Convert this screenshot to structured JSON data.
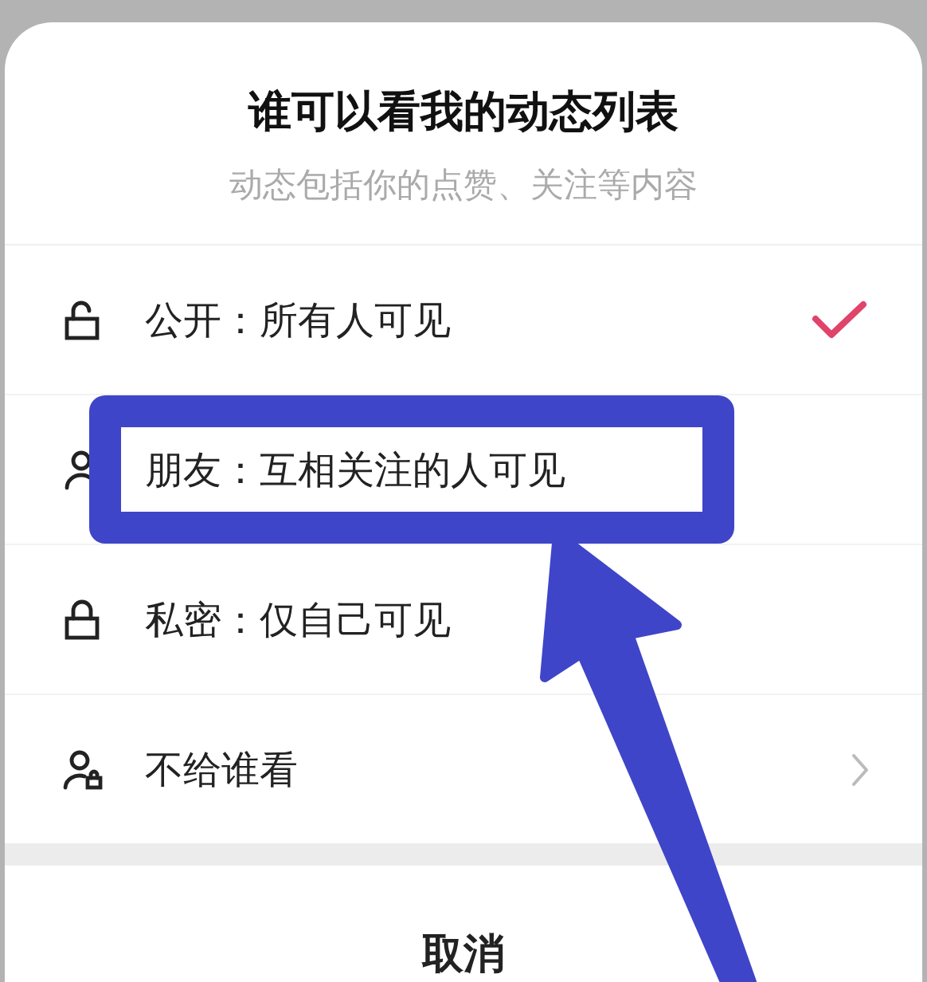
{
  "sheet": {
    "title": "谁可以看我的动态列表",
    "subtitle": "动态包括你的点赞、关注等内容"
  },
  "options": [
    {
      "kind": "unlocked",
      "label": "公开：所有人可见",
      "selected": true,
      "has_chevron": false,
      "highlighted": false
    },
    {
      "kind": "person",
      "label": "朋友：互相关注的人可见",
      "selected": false,
      "has_chevron": false,
      "highlighted": true
    },
    {
      "kind": "locked",
      "label": "私密：仅自己可见",
      "selected": false,
      "has_chevron": false,
      "highlighted": false
    },
    {
      "kind": "person-lock",
      "label": "不给谁看",
      "selected": false,
      "has_chevron": true,
      "highlighted": false
    }
  ],
  "cancel_button": "取消"
}
